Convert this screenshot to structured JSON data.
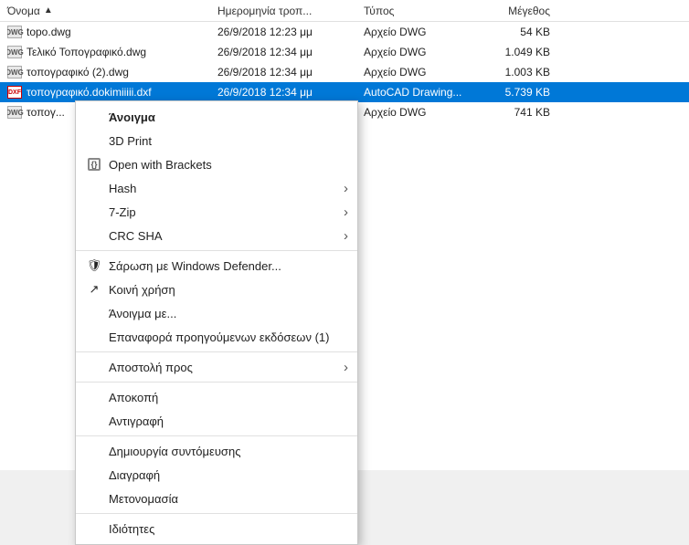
{
  "columns": {
    "name": "Όνομα",
    "date": "Ημερομηνία τροπ...",
    "type": "Τύπος",
    "size": "Μέγεθος"
  },
  "files": [
    {
      "name": "topo.dwg",
      "date": "26/9/2018 12:23 μμ",
      "type": "Αρχείο DWG",
      "size": "54 KB",
      "icon": "dwg",
      "selected": false
    },
    {
      "name": "Τελικό Τοπογραφικό.dwg",
      "date": "26/9/2018 12:34 μμ",
      "type": "Αρχείο DWG",
      "size": "1.049 KB",
      "icon": "dwg",
      "selected": false
    },
    {
      "name": "τοπογραφικό (2).dwg",
      "date": "26/9/2018 12:34 μμ",
      "type": "Αρχείο DWG",
      "size": "1.003 KB",
      "icon": "dwg",
      "selected": false
    },
    {
      "name": "τοπογραφικό.dokimiiiii.dxf",
      "date": "26/9/2018 12:34 μμ",
      "type": "AutoCAD Drawing...",
      "size": "5.739 KB",
      "icon": "dxf",
      "selected": true
    },
    {
      "name": "τοπογ...",
      "date": "",
      "type": "Αρχείο DWG",
      "size": "741 KB",
      "icon": "dwg",
      "selected": false
    }
  ],
  "context_menu": {
    "items": [
      {
        "id": "open",
        "label": "Άνοιγμα",
        "bold": true,
        "icon": null,
        "separator_after": false,
        "has_arrow": false
      },
      {
        "id": "3dprint",
        "label": "3D Print",
        "bold": false,
        "icon": null,
        "separator_after": false,
        "has_arrow": false
      },
      {
        "id": "open-brackets",
        "label": "Open with Brackets",
        "bold": false,
        "icon": "brackets",
        "separator_after": false,
        "has_arrow": false
      },
      {
        "id": "hash",
        "label": "Hash",
        "bold": false,
        "icon": null,
        "separator_after": false,
        "has_arrow": true
      },
      {
        "id": "7zip",
        "label": "7-Zip",
        "bold": false,
        "icon": null,
        "separator_after": false,
        "has_arrow": true
      },
      {
        "id": "crcsha",
        "label": "CRC SHA",
        "bold": false,
        "icon": null,
        "separator_after": true,
        "has_arrow": true
      },
      {
        "id": "defender",
        "label": "Σάρωση με Windows Defender...",
        "bold": false,
        "icon": "shield",
        "separator_after": false,
        "has_arrow": false
      },
      {
        "id": "share",
        "label": "Κοινή χρήση",
        "bold": false,
        "icon": "share",
        "separator_after": false,
        "has_arrow": false
      },
      {
        "id": "openwith",
        "label": "Άνοιγμα με...",
        "bold": false,
        "icon": null,
        "separator_after": false,
        "has_arrow": false
      },
      {
        "id": "restore",
        "label": "Επαναφορά προηγούμενων εκδόσεων (1)",
        "bold": false,
        "icon": null,
        "separator_after": true,
        "has_arrow": false
      },
      {
        "id": "sendto",
        "label": "Αποστολή προς",
        "bold": false,
        "icon": null,
        "separator_after": true,
        "has_arrow": true
      },
      {
        "id": "cut",
        "label": "Αποκοπή",
        "bold": false,
        "icon": null,
        "separator_after": false,
        "has_arrow": false
      },
      {
        "id": "copy",
        "label": "Αντιγραφή",
        "bold": false,
        "icon": null,
        "separator_after": true,
        "has_arrow": false
      },
      {
        "id": "shortcut",
        "label": "Δημιουργία συντόμευσης",
        "bold": false,
        "icon": null,
        "separator_after": false,
        "has_arrow": false
      },
      {
        "id": "delete",
        "label": "Διαγραφή",
        "bold": false,
        "icon": null,
        "separator_after": false,
        "has_arrow": false
      },
      {
        "id": "rename",
        "label": "Μετονομασία",
        "bold": false,
        "icon": null,
        "separator_after": true,
        "has_arrow": false
      },
      {
        "id": "properties",
        "label": "Ιδιότητες",
        "bold": false,
        "icon": null,
        "separator_after": false,
        "has_arrow": false
      }
    ]
  }
}
